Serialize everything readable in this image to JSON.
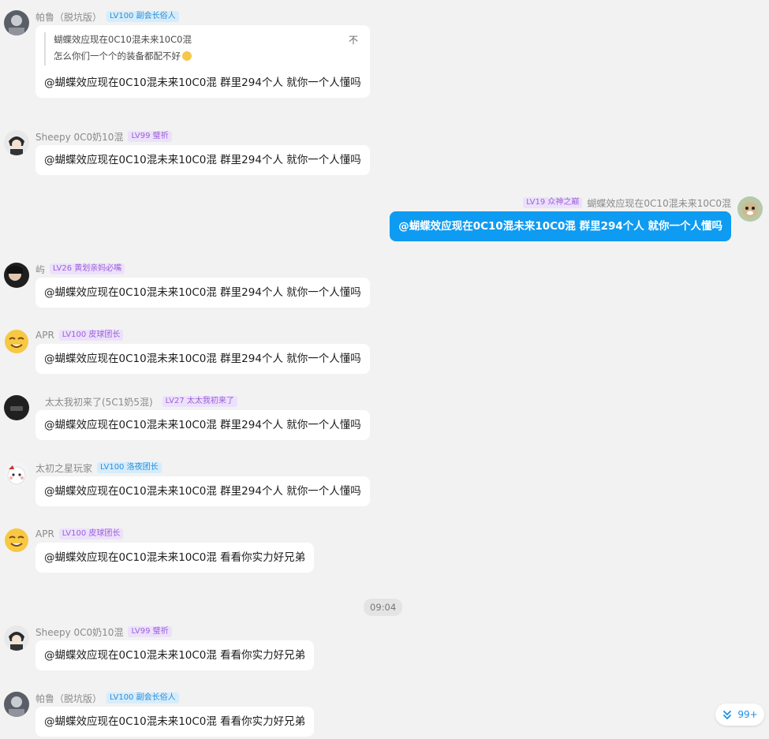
{
  "messages": [
    {
      "nick": "帕鲁（脱坑版）",
      "badge": "LV100 副会长俗人",
      "quote_author": "蝴蝶效应现在0C10混未来10C0混",
      "quote_text": "怎么你们一个个的装备都配不好",
      "quote_close": "不",
      "text": "@蝴蝶效应现在0C10混未来10C0混 群里294个人  就你一个人懂吗"
    },
    {
      "nick": "Sheepy 0C0奶10混",
      "badge": "LV99 璧祈",
      "text": "@蝴蝶效应现在0C10混未来10C0混 群里294个人  就你一个人懂吗"
    },
    {
      "nick": "蝴蝶效应现在0C10混未来10C0混",
      "badge": "LV19 众神之巅",
      "text": "@蝴蝶效应现在0C10混未来10C0混 群里294个人  就你一个人懂吗"
    },
    {
      "nick": "屿",
      "badge": "LV26 黄划亲妈必嘴",
      "text": "@蝴蝶效应现在0C10混未来10C0混 群里294个人  就你一个人懂吗"
    },
    {
      "nick": "APR",
      "badge": "LV100 皮球团长",
      "text": "@蝴蝶效应现在0C10混未来10C0混 群里294个人  就你一个人懂吗"
    },
    {
      "nick": "太太我初来了(5C1奶5混)",
      "badge": "LV27 太太我初来了",
      "text": "@蝴蝶效应现在0C10混未来10C0混 群里294个人  就你一个人懂吗"
    },
    {
      "nick": "太初之星玩家",
      "badge": "LV100 洛夜团长",
      "text": "@蝴蝶效应现在0C10混未来10C0混 群里294个人  就你一个人懂吗"
    },
    {
      "nick": "APR",
      "badge": "LV100 皮球团长",
      "text": "@蝴蝶效应现在0C10混未来10C0混 看看你实力好兄弟"
    },
    {
      "nick": "Sheepy 0C0奶10混",
      "badge": "LV99 璧祈",
      "text": "@蝴蝶效应现在0C10混未来10C0混 看看你实力好兄弟"
    },
    {
      "nick": "帕鲁（脱坑版）",
      "badge": "LV100 副会长俗人",
      "text": "@蝴蝶效应现在0C10混未来10C0混 看看你实力好兄弟"
    }
  ],
  "time_divider": "09:04",
  "unread_count": "99+"
}
